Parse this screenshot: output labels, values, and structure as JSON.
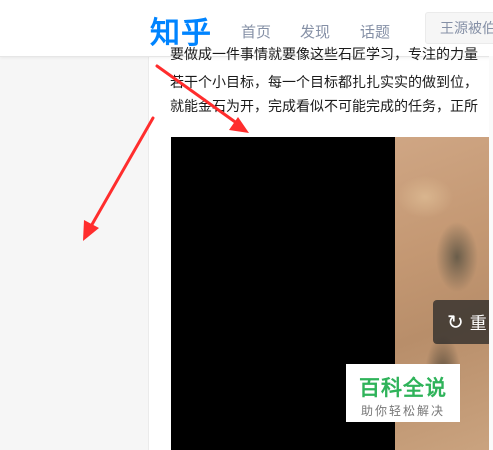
{
  "header": {
    "logo": "知乎",
    "nav": [
      "首页",
      "发现",
      "话题"
    ],
    "search_placeholder": "王源被伯"
  },
  "article": {
    "lines": [
      "要做成一件事情就要像这些石匠学习，专注的力量",
      "若干个小目标，每一个目标都扎扎实实的做到位，",
      "就能金石为开，完成看似不可能完成的任务，正所"
    ]
  },
  "video": {
    "replay_label": "重"
  },
  "watermark": {
    "title": "百科全说",
    "subtitle": "助你轻松解决"
  },
  "colors": {
    "brand": "#0084ff",
    "annotation_arrow": "#ff2d2d",
    "watermark_green": "#2fb35a"
  },
  "icons": {
    "replay": "replay-icon"
  }
}
